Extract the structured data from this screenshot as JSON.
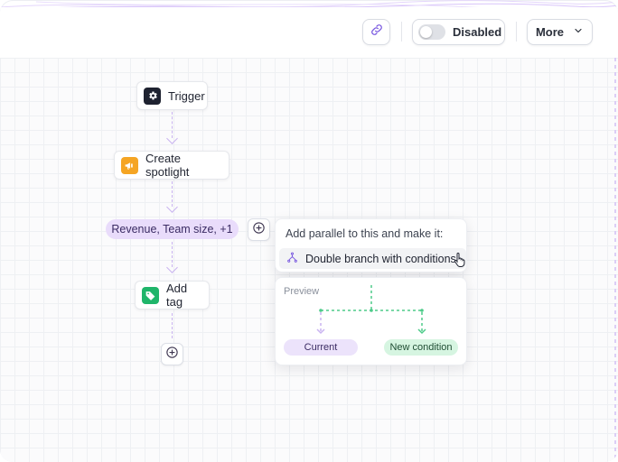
{
  "toolbar": {
    "status_label": "Disabled",
    "more_label": "More"
  },
  "flow": {
    "trigger_label": "Trigger",
    "spotlight_label": "Create spotlight",
    "condition_pill": "Revenue, Team size, +1",
    "add_tag_label": "Add tag"
  },
  "popover": {
    "title": "Add parallel to this and make it:",
    "option_label": "Double branch with conditions"
  },
  "preview": {
    "label": "Preview",
    "current_label": "Current",
    "new_condition_label": "New condition"
  },
  "colors": {
    "accent_purple": "#c9b3f0",
    "pill_purple": "#e9dcfb",
    "branch_green": "#4ecb8a",
    "spotlight_orange": "#f5a524",
    "tag_green": "#1fb56a",
    "trigger_dark": "#1e2230"
  },
  "icons": {
    "link": "link-icon",
    "settings": "gear-icon",
    "megaphone": "megaphone-icon",
    "tag": "tag-icon",
    "add": "plus-circle-icon",
    "branch": "branch-icon",
    "chevron": "chevron-down-icon",
    "cursor": "hand-pointer-icon"
  }
}
